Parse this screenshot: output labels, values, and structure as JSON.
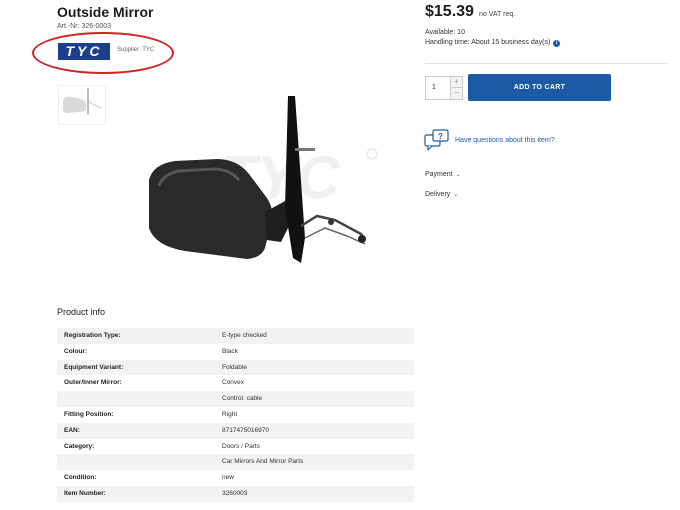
{
  "product": {
    "title": "Outside Mirror",
    "art_no": "Art.-Nr: 326-0003",
    "brand_logo_text": "TYC",
    "supplier": "Supplier: TYC",
    "watermark": "TYC"
  },
  "purchase": {
    "price": "$15.39",
    "vat": "no VAT req.",
    "available": "Available: 10",
    "handling": "Handling time: About 15 business day(s)",
    "quantity": "1",
    "add_to_cart": "ADD TO CART",
    "questions_link": "Have questions about this item?",
    "payment_label": "Payment",
    "delivery_label": "Delivery"
  },
  "product_info": {
    "heading": "Product info",
    "rows": [
      {
        "label": "Registration Type:",
        "value": "E-type checked"
      },
      {
        "label": "Colour:",
        "value": "Black"
      },
      {
        "label": "Equipment Variant:",
        "value": "Foldable"
      },
      {
        "label": "Outer/Inner Mirror:",
        "value": "Convex"
      },
      {
        "label": "",
        "value": "Control: cable"
      },
      {
        "label": "Fitting Position:",
        "value": "Right"
      },
      {
        "label": "EAN:",
        "value": "8717475016970"
      },
      {
        "label": "Category:",
        "value": "Doors / Parts"
      },
      {
        "label": "",
        "value": "Car Mirrors And Mirror Parts"
      },
      {
        "label": "Condition:",
        "value": "new"
      },
      {
        "label": "Item Number:",
        "value": "3260003"
      }
    ]
  },
  "icons": {
    "info": "info-icon",
    "question": "chat-question-icon",
    "chevron": "chevron-down-icon",
    "plus": "plus-icon",
    "minus": "minus-icon"
  },
  "colors": {
    "accent": "#1c5aa6",
    "brand_logo": "#1c3f8c",
    "highlight_circle": "#d42121",
    "row_alt": "#f2f2f2"
  }
}
